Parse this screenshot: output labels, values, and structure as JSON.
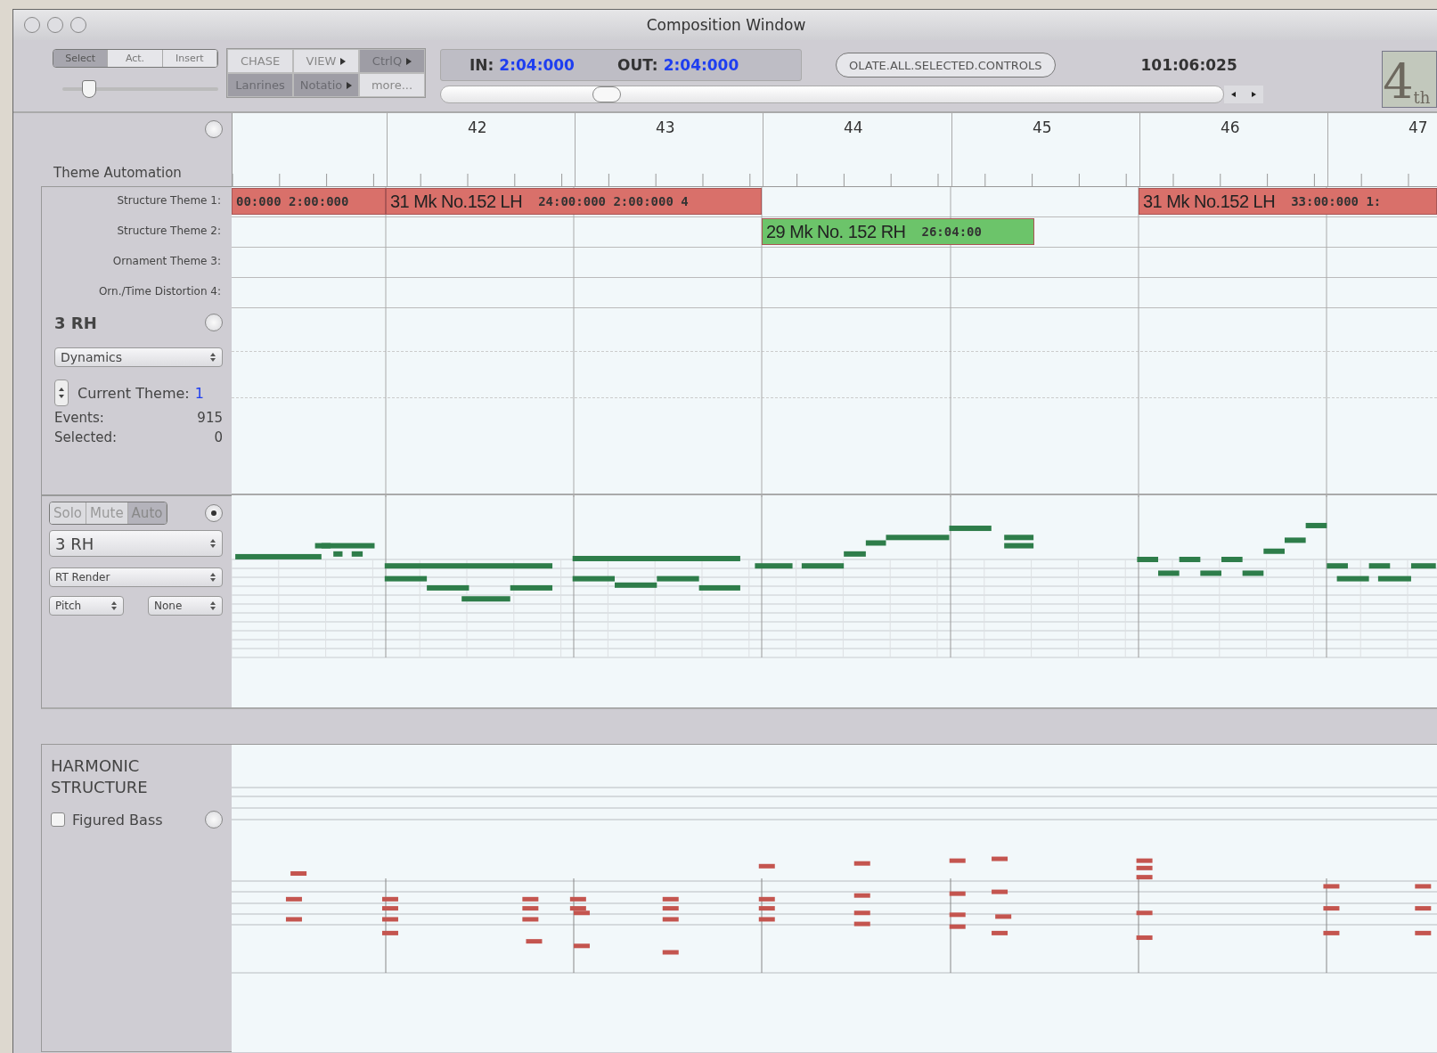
{
  "window": {
    "title": "Composition Window"
  },
  "toolbar": {
    "mode_tabs": [
      {
        "label": "Select",
        "selected": true
      },
      {
        "label": "Act.",
        "selected": false
      },
      {
        "label": "Insert",
        "selected": false
      }
    ],
    "zoom_slider": {
      "level": 0.13
    },
    "view_buttons": [
      {
        "label": "CHASE",
        "pressed": false,
        "menu": false
      },
      {
        "label": "VIEW",
        "pressed": false,
        "menu": true
      },
      {
        "label": "CtrlQ",
        "pressed": true,
        "menu": true
      },
      {
        "label": "Lanrines",
        "pressed": true,
        "menu": false
      },
      {
        "label": "Notatio",
        "pressed": true,
        "menu": true
      },
      {
        "label": "more...",
        "pressed": false,
        "menu": false
      }
    ],
    "in_label": "IN:",
    "in_value": "2:04:000",
    "out_label": "OUT:",
    "out_value": "2:04:000",
    "action_button": "OLATE.ALL.SELECTED.CONTROLS",
    "position": "101:06:025",
    "logo": {
      "main": "4",
      "suffix": "th"
    }
  },
  "theme_header": {
    "title": "Theme Automation",
    "circle_on": false
  },
  "ruler": {
    "measures": [
      "42",
      "43",
      "44",
      "45",
      "46",
      "47"
    ]
  },
  "lanes": [
    {
      "label": "Structure Theme 1:",
      "blocks": [
        {
          "timing": "00:000 2:00:000",
          "color": "#d9706a"
        },
        {
          "title": "31 Mk No.152 LH",
          "timing": "24:00:000 2:00:000 4",
          "color": "#d9706a"
        },
        {
          "title": "31 Mk No.152 LH",
          "timing": "33:00:000 1:",
          "color": "#d9706a"
        }
      ]
    },
    {
      "label": "Structure Theme 2:",
      "blocks": [
        {
          "title": "29 Mk No. 152 RH",
          "timing": "26:04:00",
          "color": "#6cc46a"
        }
      ]
    },
    {
      "label": "Ornament Theme 3:"
    },
    {
      "label": "Orn./Time Distortion 4:"
    }
  ],
  "track": {
    "name": "3 RH",
    "circle_on": false,
    "dropdown": "Dynamics",
    "theme_label": "Current Theme:",
    "theme_value": "1",
    "events_label": "Events:",
    "events_value": "915",
    "selected_label": "Selected:",
    "selected_value": "0"
  },
  "piano_track": {
    "toggles": [
      {
        "label": "Solo",
        "on": false
      },
      {
        "label": "Mute",
        "on": false
      },
      {
        "label": "Auto",
        "on": true
      }
    ],
    "circle_on": true,
    "instrument": "3 RH",
    "render": "RT Render",
    "param": "Pitch",
    "mode": "None"
  },
  "harmonic": {
    "title": "HARMONIC STRUCTURE",
    "checkbox_label": "Figured Bass",
    "checked": false,
    "circle_on": false
  }
}
